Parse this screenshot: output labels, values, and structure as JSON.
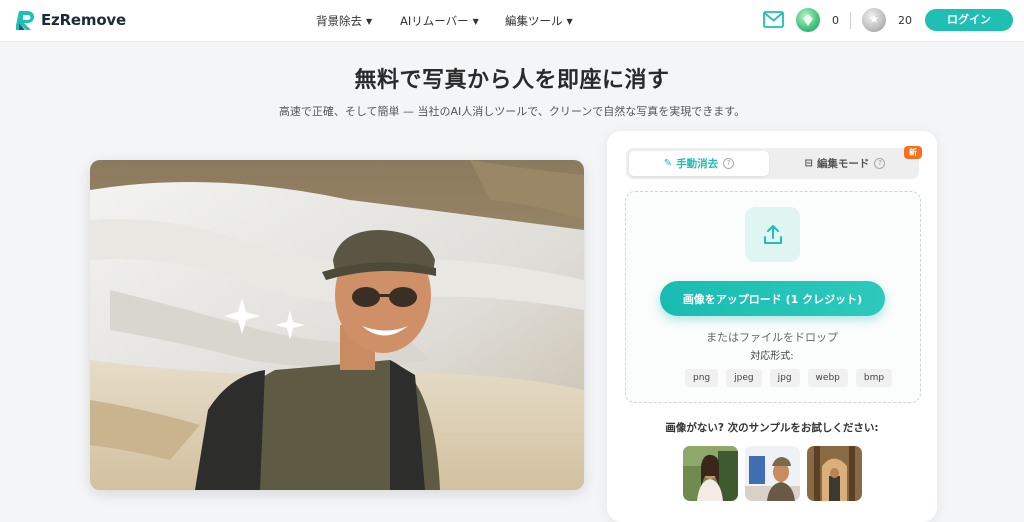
{
  "header": {
    "logo_text": "EzRemove",
    "nav": [
      {
        "label": "背景除去"
      },
      {
        "label": "AIリムーバー"
      },
      {
        "label": "編集ツール"
      }
    ],
    "credits_green": "0",
    "credits_silver": "20",
    "login_label": "ログイン"
  },
  "hero": {
    "title": "無料で写真から人を即座に消す",
    "subtitle": "高速で正確、そして簡単 — 当社のAI人消しツールで、クリーンで自然な写真を実現できます。"
  },
  "panel": {
    "tab_manual": "手動消去",
    "tab_edit": "編集モード",
    "new_badge": "新",
    "upload_button": "画像をアップロード (1 クレジット)",
    "drop_text": "またはファイルをドロップ",
    "formats_label": "対応形式:",
    "formats": [
      "png",
      "jpeg",
      "jpg",
      "webp",
      "bmp"
    ],
    "sample_title": "画像がない? 次のサンプルをお試しください:"
  },
  "colors": {
    "accent": "#1fbfb4",
    "badge": "#f37021",
    "background": "#f4f5f7"
  }
}
